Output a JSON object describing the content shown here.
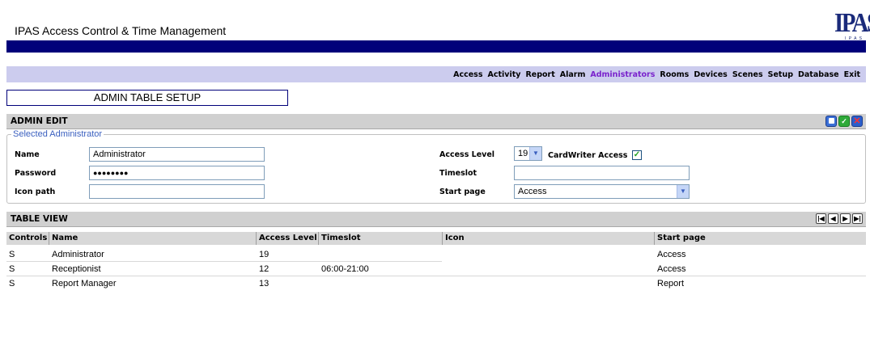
{
  "app": {
    "title": "IPAS Access Control & Time Management",
    "logo_text": "IPAS",
    "logo_sub": "I P A S",
    "colors": {
      "band": "#00007a",
      "nav_bg": "#ccccee",
      "nav_active": "#7a22cc"
    }
  },
  "nav": {
    "items": [
      "Access",
      "Activity",
      "Report",
      "Alarm",
      "Administrators",
      "Rooms",
      "Devices",
      "Scenes",
      "Setup",
      "Database",
      "Exit"
    ],
    "active": "Administrators"
  },
  "page_heading": "ADMIN TABLE SETUP",
  "admin_edit": {
    "title": "ADMIN EDIT",
    "icons": [
      "new-record-icon",
      "save-check-icon",
      "cancel-x-icon"
    ],
    "group_legend": "Selected Administrator",
    "name_label": "Name",
    "name_value": "Administrator",
    "password_label": "Password",
    "password_value": "●●●●●●●●",
    "icon_path_label": "Icon path",
    "icon_path_value": "",
    "access_level_label": "Access Level",
    "access_level_value": "19",
    "cardwriter_label": "CardWriter Access",
    "cardwriter_checked": true,
    "timeslot_label": "Timeslot",
    "timeslot_value": "",
    "start_page_label": "Start page",
    "start_page_value": "Access"
  },
  "table_view": {
    "title": "TABLE VIEW",
    "nav_icons": [
      "first-page-icon",
      "prev-page-icon",
      "next-page-icon",
      "last-page-icon"
    ],
    "columns": [
      "Controls",
      "Name",
      "Access Level",
      "Timeslot",
      "Icon",
      "Start page"
    ],
    "rows": [
      {
        "controls": "S",
        "name": "Administrator",
        "access_level": "19",
        "timeslot": "",
        "icon": "",
        "start_page": "Access"
      },
      {
        "controls": "S",
        "name": "Receptionist",
        "access_level": "12",
        "timeslot": "06:00-21:00",
        "icon": "",
        "start_page": "Access"
      },
      {
        "controls": "S",
        "name": "Report Manager",
        "access_level": "13",
        "timeslot": "",
        "icon": "",
        "start_page": "Report"
      }
    ]
  }
}
